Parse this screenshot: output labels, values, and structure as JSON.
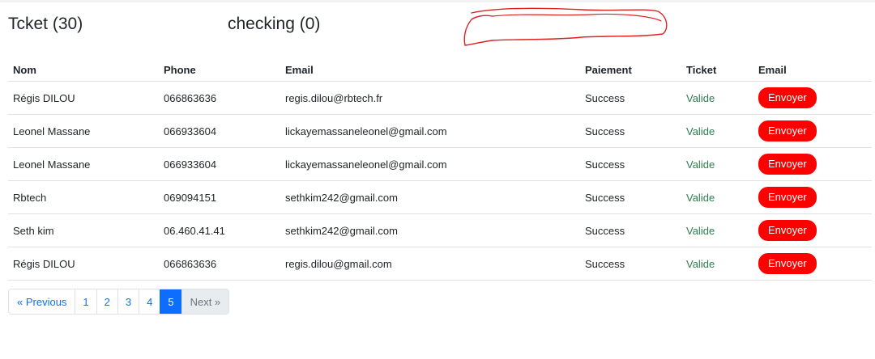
{
  "header": {
    "tickets_title": "Tcket (30)",
    "checking_title": "checking (0)"
  },
  "table": {
    "columns": [
      "Nom",
      "Phone",
      "Email",
      "Paiement",
      "Ticket",
      "Email"
    ],
    "rows": [
      {
        "nom": "Régis DILOU",
        "phone": "066863636",
        "email": "regis.dilou@rbtech.fr",
        "paiement": "Success",
        "ticket": "Valide",
        "action": "Envoyer"
      },
      {
        "nom": "Leonel Massane",
        "phone": "066933604",
        "email": "lickayemassaneleonel@gmail.com",
        "paiement": "Success",
        "ticket": "Valide",
        "action": "Envoyer"
      },
      {
        "nom": "Leonel Massane",
        "phone": "066933604",
        "email": "lickayemassaneleonel@gmail.com",
        "paiement": "Success",
        "ticket": "Valide",
        "action": "Envoyer"
      },
      {
        "nom": "Rbtech",
        "phone": "069094151",
        "email": "sethkim242@gmail.com",
        "paiement": "Success",
        "ticket": "Valide",
        "action": "Envoyer"
      },
      {
        "nom": "Seth kim",
        "phone": "06.460.41.41",
        "email": "sethkim242@gmail.com",
        "paiement": "Success",
        "ticket": "Valide",
        "action": "Envoyer"
      },
      {
        "nom": "Régis DILOU",
        "phone": "066863636",
        "email": "regis.dilou@gmail.com",
        "paiement": "Success",
        "ticket": "Valide",
        "action": "Envoyer"
      }
    ]
  },
  "pagination": {
    "previous": "« Previous",
    "pages": [
      "1",
      "2",
      "3",
      "4",
      "5"
    ],
    "active_page": "5",
    "next": "Next »"
  },
  "colors": {
    "send_button": "#ff0000",
    "valid_status": "#2e7d4f",
    "link": "#0d6efd",
    "redaction_scribble": "#e02020"
  }
}
